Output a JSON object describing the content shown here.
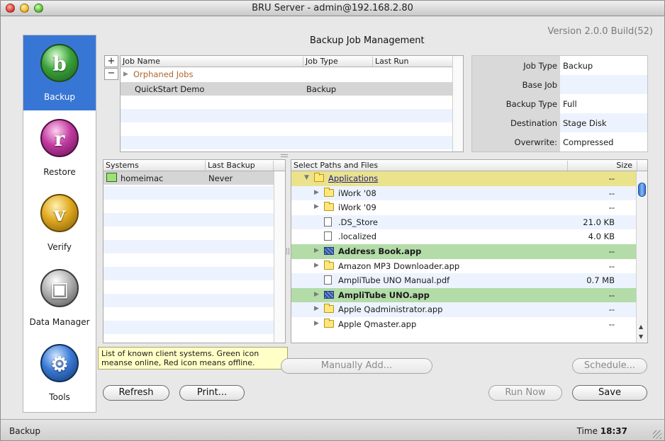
{
  "window": {
    "title": "BRU Server - admin@192.168.2.80"
  },
  "header": {
    "title": "Backup Job Management",
    "version": "Version 2.0.0 Build(52)"
  },
  "sidebar": {
    "items": [
      {
        "label": "Backup",
        "icon": "backup-icon",
        "selected": true
      },
      {
        "label": "Restore",
        "icon": "restore-icon",
        "selected": false
      },
      {
        "label": "Verify",
        "icon": "verify-icon",
        "selected": false
      },
      {
        "label": "Data Manager",
        "icon": "data-manager-icon",
        "selected": false
      },
      {
        "label": "Tools",
        "icon": "tools-icon",
        "selected": false
      }
    ]
  },
  "jobs": {
    "add_label": "+",
    "remove_label": "−",
    "columns": [
      "Job Name",
      "Job Type",
      "Last Run"
    ],
    "rows": [
      {
        "name": "Orphaned Jobs",
        "type": "",
        "last_run": ""
      },
      {
        "name": "QuickStart Demo",
        "type": "Backup",
        "last_run": ""
      }
    ]
  },
  "properties": [
    {
      "label": "Job Type",
      "value": "Backup"
    },
    {
      "label": "Base Job",
      "value": ""
    },
    {
      "label": "Backup Type",
      "value": "Full"
    },
    {
      "label": "Destination",
      "value": "Stage Disk"
    },
    {
      "label": "Overwrite:",
      "value": "Compressed"
    }
  ],
  "systems": {
    "columns": [
      "Systems",
      "Last Backup"
    ],
    "rows": [
      {
        "name": "homeimac",
        "last_backup": "Never"
      }
    ]
  },
  "paths": {
    "columns": [
      "Select Paths and Files",
      "Size"
    ],
    "rows": [
      {
        "name": "Applications",
        "size": "--",
        "kind": "apps-folder",
        "expanded": true,
        "depth": 0,
        "highlight": "yellow"
      },
      {
        "name": "iWork '08",
        "size": "--",
        "kind": "folder",
        "expanded": false,
        "depth": 1,
        "highlight": ""
      },
      {
        "name": "iWork '09",
        "size": "--",
        "kind": "folder",
        "expanded": false,
        "depth": 1,
        "highlight": ""
      },
      {
        "name": ".DS_Store",
        "size": "21.0 KB",
        "kind": "file",
        "depth": 1,
        "highlight": ""
      },
      {
        "name": ".localized",
        "size": "4.0 KB",
        "kind": "file",
        "depth": 1,
        "highlight": ""
      },
      {
        "name": "Address Book.app",
        "size": "--",
        "kind": "app",
        "expanded": false,
        "depth": 1,
        "highlight": "green"
      },
      {
        "name": "Amazon MP3 Downloader.app",
        "size": "--",
        "kind": "folder",
        "expanded": false,
        "depth": 1,
        "highlight": ""
      },
      {
        "name": "AmpliTube UNO Manual.pdf",
        "size": "0.7 MB",
        "kind": "file",
        "depth": 1,
        "highlight": ""
      },
      {
        "name": "AmpliTube UNO.app",
        "size": "--",
        "kind": "app",
        "expanded": false,
        "depth": 1,
        "highlight": "green"
      },
      {
        "name": "Apple Qadministrator.app",
        "size": "--",
        "kind": "folder",
        "expanded": false,
        "depth": 1,
        "highlight": ""
      },
      {
        "name": "Apple Qmaster.app",
        "size": "--",
        "kind": "folder",
        "expanded": false,
        "depth": 1,
        "highlight": ""
      }
    ]
  },
  "tooltip": {
    "text": "List of known client systems. Green icon meanse online, Red icon means offline."
  },
  "buttons": {
    "manually_add": "Manually Add...",
    "schedule": "Schedule...",
    "refresh": "Refresh",
    "print": "Print...",
    "run_now": "Run Now",
    "save": "Save"
  },
  "status": {
    "left": "Backup",
    "time_label": "Time",
    "time": "18:37"
  },
  "colors": {
    "selection_blue": "#3876d6",
    "row_alt": "#edf3fe",
    "highlight_yellow": "#ebe28c",
    "highlight_green": "#b3dca8",
    "tooltip_bg": "#ffffc7"
  }
}
